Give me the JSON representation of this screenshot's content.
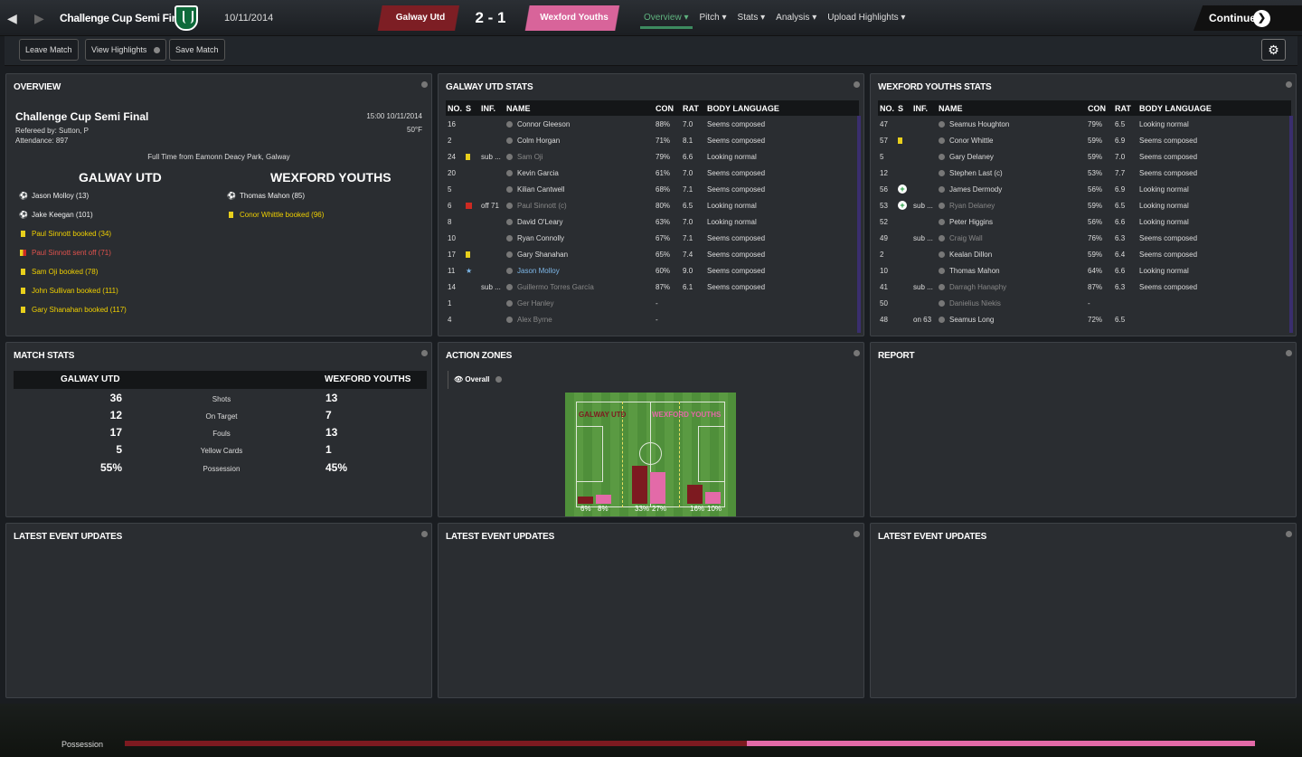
{
  "header": {
    "competition": "Challenge Cup Semi Final",
    "date": "10/11/2014",
    "home_team": "Galway Utd",
    "score": "2 - 1",
    "away_team": "Wexford Youths",
    "menu": [
      "Overview",
      "Pitch",
      "Stats",
      "Analysis",
      "Upload Highlights"
    ],
    "continue_label": "Continue"
  },
  "toolbar": {
    "leave": "Leave Match",
    "highlights": "View Highlights",
    "save": "Save Match"
  },
  "overview": {
    "title": "OVERVIEW",
    "match_title": "Challenge Cup Semi Final",
    "referee": "Refereed by: Sutton, P",
    "attendance": "Attendance: 897",
    "time": "15:00 10/11/2014",
    "temperature": "50°F",
    "venue": "Full Time from Eamonn Deacy Park, Galway",
    "home_name": "GALWAY UTD",
    "away_name": "WEXFORD YOUTHS",
    "home_events": [
      {
        "type": "goal",
        "text": "Jason Molloy (13)"
      },
      {
        "type": "goal",
        "text": "Jake Keegan (101)"
      },
      {
        "type": "yellow",
        "text": "Paul Sinnott booked (34)"
      },
      {
        "type": "red",
        "text": "Paul Sinnott sent off (71)"
      },
      {
        "type": "yellow",
        "text": "Sam Oji booked (78)"
      },
      {
        "type": "yellow",
        "text": "John Sullivan booked (111)"
      },
      {
        "type": "yellow",
        "text": "Gary Shanahan booked (117)"
      }
    ],
    "away_events": [
      {
        "type": "goal",
        "text": "Thomas Mahon (85)"
      },
      {
        "type": "yellow",
        "text": "Conor Whittle booked (96)"
      }
    ]
  },
  "galway_stats": {
    "title": "GALWAY UTD STATS",
    "columns": [
      "NO.",
      "S",
      "INF.",
      "NAME",
      "CON",
      "RAT",
      "BODY LANGUAGE"
    ],
    "rows": [
      {
        "no": "16",
        "s": "",
        "inf": "",
        "name": "Connor Gleeson",
        "con": "88%",
        "rat": "7.0",
        "body": "Seems composed",
        "dim": false
      },
      {
        "no": "2",
        "s": "",
        "inf": "",
        "name": "Colm Horgan",
        "con": "71%",
        "rat": "8.1",
        "body": "Seems composed",
        "dim": false
      },
      {
        "no": "24",
        "s": "yellow",
        "inf": "sub ...",
        "name": "Sam Oji",
        "con": "79%",
        "rat": "6.6",
        "body": "Looking normal",
        "dim": true
      },
      {
        "no": "20",
        "s": "",
        "inf": "",
        "name": "Kevin Garcia",
        "con": "61%",
        "rat": "7.0",
        "body": "Seems composed",
        "dim": false
      },
      {
        "no": "5",
        "s": "",
        "inf": "",
        "name": "Kilian Cantwell",
        "con": "68%",
        "rat": "7.1",
        "body": "Seems composed",
        "dim": false
      },
      {
        "no": "6",
        "s": "red",
        "inf": "off 71",
        "name": "Paul Sinnott (c)",
        "con": "80%",
        "rat": "6.5",
        "body": "Looking normal",
        "dim": true
      },
      {
        "no": "8",
        "s": "",
        "inf": "",
        "name": "David O'Leary",
        "con": "63%",
        "rat": "7.0",
        "body": "Looking normal",
        "dim": false
      },
      {
        "no": "10",
        "s": "",
        "inf": "",
        "name": "Ryan Connolly",
        "con": "67%",
        "rat": "7.1",
        "body": "Seems composed",
        "dim": false
      },
      {
        "no": "17",
        "s": "yellow",
        "inf": "",
        "name": "Gary Shanahan",
        "con": "65%",
        "rat": "7.4",
        "body": "Seems composed",
        "dim": false
      },
      {
        "no": "11",
        "s": "star",
        "inf": "",
        "name": "Jason Molloy",
        "con": "60%",
        "rat": "9.0",
        "body": "Seems composed",
        "dim": false
      },
      {
        "no": "14",
        "s": "",
        "inf": "sub ...",
        "name": "Guillermo Torres García",
        "con": "87%",
        "rat": "6.1",
        "body": "Seems composed",
        "dim": true
      },
      {
        "no": "1",
        "s": "",
        "inf": "",
        "name": "Ger Hanley",
        "con": "-",
        "rat": "",
        "body": "",
        "dim": true
      },
      {
        "no": "4",
        "s": "",
        "inf": "",
        "name": "Alex Byrne",
        "con": "-",
        "rat": "",
        "body": "",
        "dim": true
      }
    ]
  },
  "wexford_stats": {
    "title": "WEXFORD YOUTHS STATS",
    "columns": [
      "NO.",
      "S",
      "INF.",
      "NAME",
      "CON",
      "RAT",
      "BODY LANGUAGE"
    ],
    "rows": [
      {
        "no": "47",
        "s": "",
        "inf": "",
        "name": "Seamus Houghton",
        "con": "79%",
        "rat": "6.5",
        "body": "Looking normal",
        "dim": false
      },
      {
        "no": "57",
        "s": "yellow",
        "inf": "",
        "name": "Conor Whittle",
        "con": "59%",
        "rat": "6.9",
        "body": "Seems composed",
        "dim": false
      },
      {
        "no": "5",
        "s": "",
        "inf": "",
        "name": "Gary Delaney",
        "con": "59%",
        "rat": "7.0",
        "body": "Seems composed",
        "dim": false
      },
      {
        "no": "12",
        "s": "",
        "inf": "",
        "name": "Stephen Last (c)",
        "con": "53%",
        "rat": "7.7",
        "body": "Seems composed",
        "dim": false
      },
      {
        "no": "56",
        "s": "plus",
        "inf": "",
        "name": "James Dermody",
        "con": "56%",
        "rat": "6.9",
        "body": "Looking normal",
        "dim": false
      },
      {
        "no": "53",
        "s": "plus",
        "inf": "sub ...",
        "name": "Ryan Delaney",
        "con": "59%",
        "rat": "6.5",
        "body": "Looking normal",
        "dim": true
      },
      {
        "no": "52",
        "s": "",
        "inf": "",
        "name": "Peter Higgins",
        "con": "56%",
        "rat": "6.6",
        "body": "Looking normal",
        "dim": false
      },
      {
        "no": "49",
        "s": "",
        "inf": "sub ...",
        "name": "Craig Wall",
        "con": "76%",
        "rat": "6.3",
        "body": "Seems composed",
        "dim": true
      },
      {
        "no": "2",
        "s": "",
        "inf": "",
        "name": "Kealan Dillon",
        "con": "59%",
        "rat": "6.4",
        "body": "Seems composed",
        "dim": false
      },
      {
        "no": "10",
        "s": "",
        "inf": "",
        "name": "Thomas Mahon",
        "con": "64%",
        "rat": "6.6",
        "body": "Looking normal",
        "dim": false
      },
      {
        "no": "41",
        "s": "",
        "inf": "sub ...",
        "name": "Darragh Hanaphy",
        "con": "87%",
        "rat": "6.3",
        "body": "Seems composed",
        "dim": true
      },
      {
        "no": "50",
        "s": "",
        "inf": "",
        "name": "Danielius Niekis",
        "con": "-",
        "rat": "",
        "body": "",
        "dim": true
      },
      {
        "no": "48",
        "s": "",
        "inf": "on 63",
        "name": "Seamus Long",
        "con": "72%",
        "rat": "6.5",
        "body": "",
        "dim": false
      }
    ]
  },
  "match_stats": {
    "title": "MATCH STATS",
    "home": "GALWAY UTD",
    "away": "WEXFORD YOUTHS",
    "rows": [
      {
        "label": "Shots",
        "home": "36",
        "away": "13"
      },
      {
        "label": "On Target",
        "home": "12",
        "away": "7"
      },
      {
        "label": "Fouls",
        "home": "17",
        "away": "13"
      },
      {
        "label": "Yellow Cards",
        "home": "5",
        "away": "1"
      },
      {
        "label": "Possession",
        "home": "55%",
        "away": "45%"
      }
    ]
  },
  "action_zones": {
    "title": "ACTION ZONES",
    "filter": "Overall",
    "home_label": "GALWAY UTD",
    "away_label": "WEXFORD YOUTHS",
    "zones": [
      {
        "home": 6,
        "away": 8,
        "home_label": "6%",
        "away_label": "8%"
      },
      {
        "home": 33,
        "away": 27,
        "home_label": "33%",
        "away_label": "27%"
      },
      {
        "home": 16,
        "away": 10,
        "home_label": "16%",
        "away_label": "10%"
      }
    ],
    "colors": {
      "home": "#7d1a20",
      "away": "#e36aa8"
    }
  },
  "report": {
    "title": "REPORT"
  },
  "latest": {
    "title": "LATEST EVENT UPDATES"
  },
  "possession_bar": {
    "label": "Possession",
    "home_fraction": 0.55
  }
}
